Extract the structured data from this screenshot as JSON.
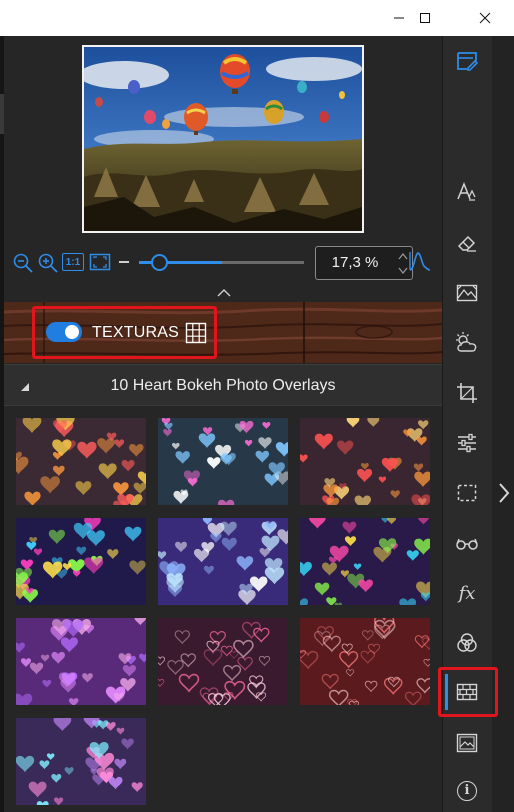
{
  "titlebar": {
    "buttons": [
      "minimize",
      "maximize",
      "close"
    ]
  },
  "preview": {
    "alt": "Hot air balloons over Cappadocia"
  },
  "zoom": {
    "zoom_out_icon": "zoom-out-icon",
    "zoom_in_icon": "zoom-in-icon",
    "one_to_one_label": "1:1",
    "fit_icon": "fit-screen-icon",
    "slider_fraction": 0.12,
    "value": "17,3 %",
    "histogram_icon": "histogram-icon"
  },
  "textures": {
    "enabled": true,
    "label": "TEXTURAS",
    "grid_icon": "grid-view-icon"
  },
  "group": {
    "title": "10 Heart Bokeh Photo Overlays",
    "expanded": true
  },
  "thumbnails": [
    {
      "name": "bokeh-1",
      "colors": [
        "#ff5b5b",
        "#ff9a3d",
        "#ffd24a"
      ],
      "bg": "#3b2a33"
    },
    {
      "name": "bokeh-2",
      "colors": [
        "#ff6fd8",
        "#7fc8ff",
        "#ffffff"
      ],
      "bg": "#273848"
    },
    {
      "name": "bokeh-3",
      "colors": [
        "#ff5252",
        "#ff9a3d",
        "#ffd97a"
      ],
      "bg": "#3a2630"
    },
    {
      "name": "bokeh-4",
      "colors": [
        "#ff3fbf",
        "#3fd0ff",
        "#8cff4a",
        "#ffe14a"
      ],
      "bg": "#201a4a"
    },
    {
      "name": "bokeh-5",
      "colors": [
        "#bfe7ff",
        "#8fb6ff",
        "#ffffff"
      ],
      "bg": "#3a2a7a"
    },
    {
      "name": "bokeh-6",
      "colors": [
        "#ff4aa8",
        "#36e0ff",
        "#8cff4a",
        "#ffe14a"
      ],
      "bg": "#2a1a4a"
    },
    {
      "name": "bokeh-7",
      "colors": [
        "#e58cff",
        "#ffb4f2",
        "#b36bff"
      ],
      "bg": "#5a2a7a"
    },
    {
      "name": "bokeh-8",
      "colors": [
        "#ff6b9e",
        "#ffd0e0"
      ],
      "bg": "#3a1a2e"
    },
    {
      "name": "bokeh-9",
      "colors": [
        "#ff7b7b",
        "#ffd0d0"
      ],
      "bg": "#5a1a1e"
    },
    {
      "name": "bokeh-10",
      "colors": [
        "#7ff0ff",
        "#ff8ad8",
        "#c98bff"
      ],
      "bg": "#3a2a5a"
    }
  ],
  "sidebar": {
    "items": [
      {
        "name": "edit-icon",
        "active": false
      },
      {
        "name": "text-icon",
        "active": false
      },
      {
        "name": "eraser-icon",
        "active": false
      },
      {
        "name": "landscape-icon",
        "active": false
      },
      {
        "name": "weather-icon",
        "active": false
      },
      {
        "name": "crop-icon",
        "active": false
      },
      {
        "name": "adjustments-icon",
        "active": false
      },
      {
        "name": "selection-icon",
        "active": false
      },
      {
        "name": "glasses-icon",
        "active": false
      },
      {
        "name": "fx-icon",
        "active": false
      },
      {
        "name": "color-mix-icon",
        "active": false
      },
      {
        "name": "texture-icon",
        "active": true
      },
      {
        "name": "image-icon",
        "active": false
      },
      {
        "name": "info-icon",
        "active": false
      }
    ],
    "fx_label": "fx",
    "info_label": "i"
  },
  "colors": {
    "accent": "#2f8ce8",
    "highlight": "#e3151c",
    "panel": "#262626"
  }
}
